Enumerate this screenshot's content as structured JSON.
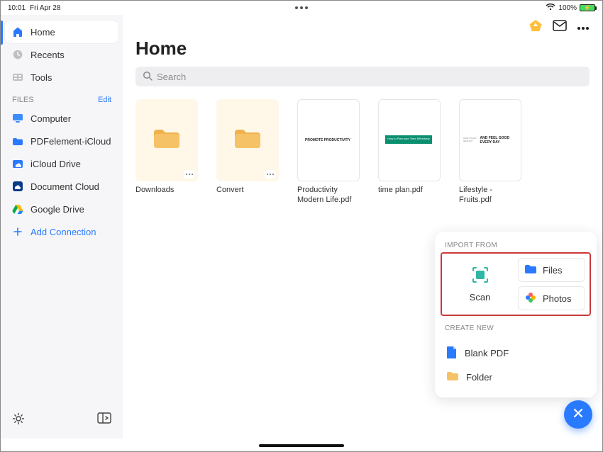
{
  "status": {
    "time": "10:01",
    "date": "Fri Apr 28",
    "battery": "100%"
  },
  "header": {
    "title": "Home",
    "search_placeholder": "Search"
  },
  "sidebar": {
    "nav": [
      {
        "label": "Home",
        "icon": "home-icon"
      },
      {
        "label": "Recents",
        "icon": "clock-icon"
      },
      {
        "label": "Tools",
        "icon": "tools-icon"
      }
    ],
    "files_header": "FILES",
    "edit_label": "Edit",
    "locations": [
      {
        "label": "Computer",
        "icon": "computer-icon"
      },
      {
        "label": "PDFelement-iCloud",
        "icon": "icloud-folder-icon"
      },
      {
        "label": "iCloud Drive",
        "icon": "icloud-drive-icon"
      },
      {
        "label": "Document Cloud",
        "icon": "document-cloud-icon"
      },
      {
        "label": "Google Drive",
        "icon": "google-drive-icon"
      }
    ],
    "add_connection": "Add Connection"
  },
  "items": [
    {
      "label": "Downloads",
      "kind": "folder"
    },
    {
      "label": "Convert",
      "kind": "folder"
    },
    {
      "label": "Productivity Modern Life.pdf",
      "kind": "doc",
      "headline": "PROMOTE PRODUCTIVITY"
    },
    {
      "label": "time plan.pdf",
      "kind": "doc",
      "headline": "How to Plan your Time Effectively"
    },
    {
      "label": "Lifestyle - Fruits.pdf",
      "kind": "doc",
      "headline": "AND FEEL GOOD EVERY DAY"
    }
  ],
  "popup": {
    "import_label": "IMPORT FROM",
    "scan": "Scan",
    "files": "Files",
    "photos": "Photos",
    "create_label": "CREATE NEW",
    "blank_pdf": "Blank PDF",
    "folder": "Folder"
  },
  "colors": {
    "accent": "#2a7aff"
  }
}
